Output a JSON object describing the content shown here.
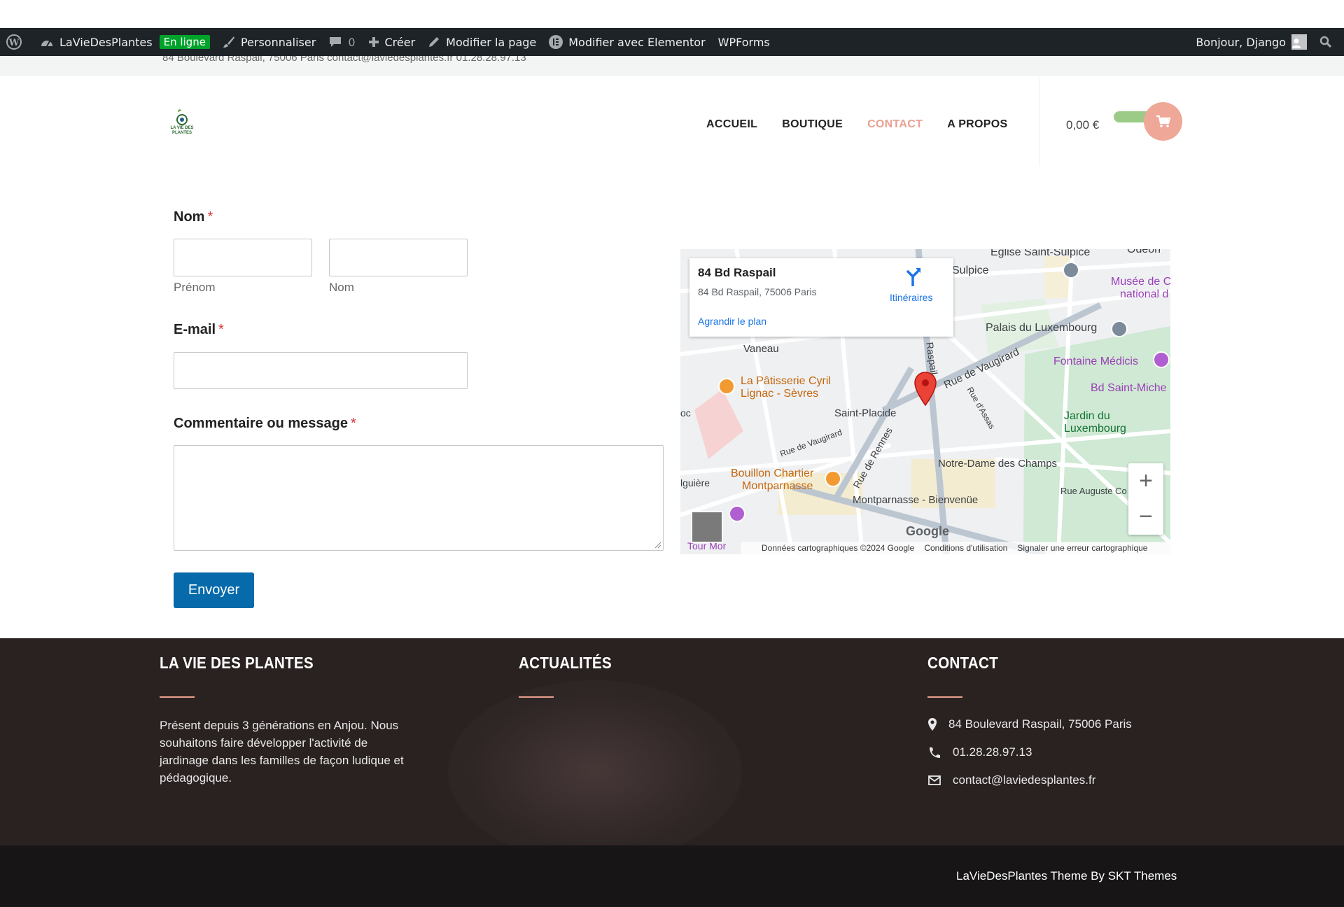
{
  "adminbar": {
    "site_name": "LaVieDesPlantes",
    "status_badge": "En ligne",
    "customize": "Personnaliser",
    "comments_count": "0",
    "create": "Créer",
    "edit_page": "Modifier la page",
    "edit_elementor": "Modifier avec Elementor",
    "wpforms": "WPForms",
    "greeting": "Bonjour, Django"
  },
  "topbar": {
    "ghost_text": "84 Boulevard Raspail, 75006 Paris     contact@laviedesplantes.fr     01.28.28.97.13"
  },
  "header": {
    "logo_text": "LA VIE DES PLANTES",
    "nav": [
      "ACCUEIL",
      "BOUTIQUE",
      "CONTACT",
      "A PROPOS"
    ],
    "active_nav": "CONTACT",
    "cart_total": "0,00 €"
  },
  "form": {
    "name_label": "Nom",
    "first_sub": "Prénom",
    "last_sub": "Nom",
    "email_label": "E-mail",
    "message_label": "Commentaire ou message",
    "required_mark": "*",
    "submit": "Envoyer"
  },
  "map": {
    "place_title": "84 Bd Raspail",
    "place_address": "84 Bd Raspail, 75006 Paris",
    "directions": "Itinéraires",
    "enlarge": "Agrandir le plan",
    "labels": {
      "eglise": "Eglise Saint-Sulpice",
      "odeon": "Odéon",
      "sulpice": "Sulpice",
      "musee": "Musée de C",
      "musee2": "national d",
      "palais": "Palais du Luxembourg",
      "vaneau": "Vaneau",
      "raspail": "Raspail",
      "vaugirard": "Rue de Vaugirard",
      "fontaine": "Fontaine Médicis",
      "patisserie1": "La Pâtisserie Cyril",
      "patisserie2": "Lignac - Sèvres",
      "bdsaintmichel": "Bd Saint-Miche",
      "assas": "Rue d'Assas",
      "jardin1": "Jardin du",
      "jardin2": "Luxembourg",
      "saintplacide": "Saint-Placide",
      "oc": "oc",
      "vaugirard2": "Rue de Vaugirard",
      "rennes": "Rue de Rennes",
      "notredame": "Notre-Dame des Champs",
      "bouillon1": "Bouillon Chartier",
      "bouillon2": "Montparnasse",
      "falguiere": "lguière",
      "montparnasse": "Montparnasse - Bienvenüe",
      "augusteco": "Rue Auguste Co",
      "tourmont": "Tour Mor"
    },
    "google": "Google",
    "attribution": [
      "Données cartographiques ©2024 Google",
      "Conditions d'utilisation",
      "Signaler une erreur cartographique"
    ]
  },
  "footer": {
    "col1_title": "LA VIE DES PLANTES",
    "col1_text": "Présent depuis 3 générations en Anjou. Nous souhaitons faire développer l'activité de jardinage dans les familles de façon ludique et pédagogique.",
    "col2_title": "ACTUALITÉS",
    "col3_title": "CONTACT",
    "address": "84 Boulevard Raspail, 75006 Paris",
    "phone": "01.28.28.97.13",
    "email": "contact@laviedesplantes.fr",
    "copyright": "LaVieDesPlantes Theme By SKT Themes"
  },
  "colors": {
    "accent": "#e9a090",
    "admin_bg": "#1d2327",
    "submit": "#066aab",
    "footer_bg": "#2a2221",
    "copy_bg": "#171515"
  }
}
